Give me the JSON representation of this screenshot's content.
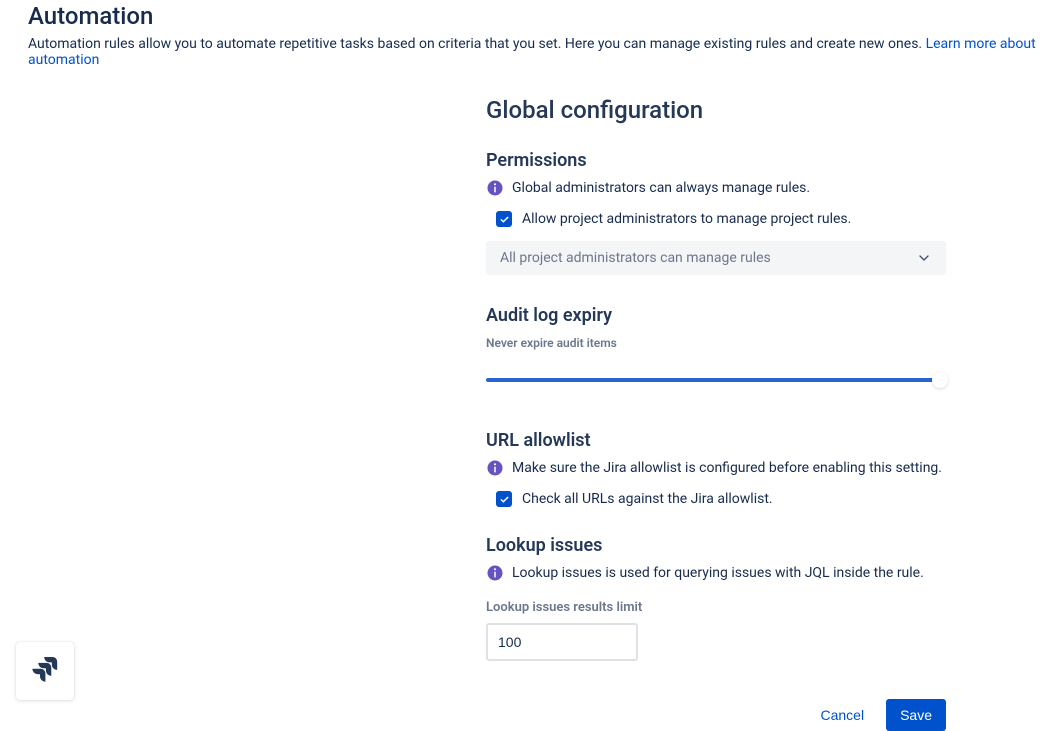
{
  "header": {
    "title": "Automation",
    "description": "Automation rules allow you to automate repetitive tasks based on criteria that you set. Here you can manage existing rules and create new ones. ",
    "learn_more": "Learn more about automation"
  },
  "global": {
    "title": "Global configuration",
    "permissions": {
      "title": "Permissions",
      "info": "Global administrators can always manage rules.",
      "checkbox_label": "Allow project administrators to manage project rules.",
      "checkbox_checked": true,
      "select_value": "All project administrators can manage rules"
    },
    "audit": {
      "title": "Audit log expiry",
      "slider_label": "Never expire audit items",
      "slider_percent": 100
    },
    "url_allowlist": {
      "title": "URL allowlist",
      "info": "Make sure the Jira allowlist is configured before enabling this setting.",
      "checkbox_label": "Check all URLs against the Jira allowlist.",
      "checkbox_checked": true
    },
    "lookup": {
      "title": "Lookup issues",
      "info": "Lookup issues is used for querying issues with JQL inside the rule.",
      "field_label": "Lookup issues results limit",
      "value": "100"
    }
  },
  "actions": {
    "cancel": "Cancel",
    "save": "Save"
  }
}
